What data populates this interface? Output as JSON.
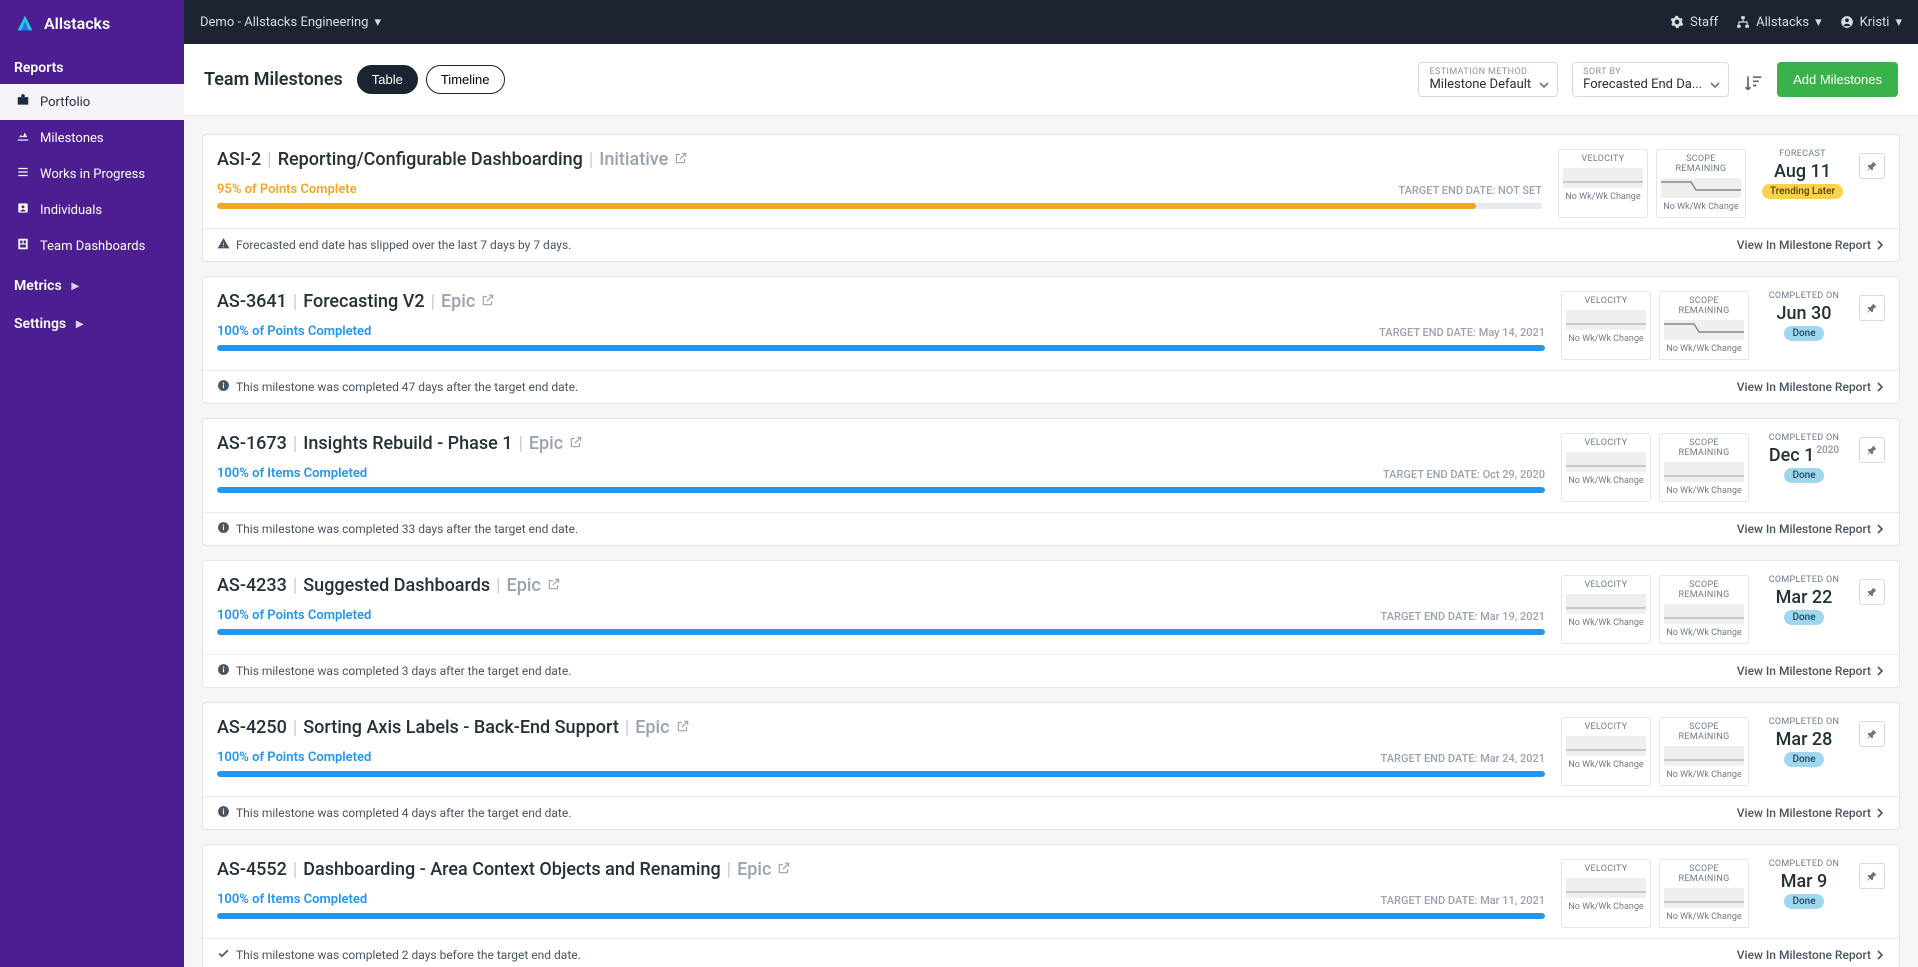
{
  "brand": {
    "name": "Allstacks"
  },
  "topbar": {
    "org": "Demo - Allstacks Engineering",
    "staff": "Staff",
    "product": "Allstacks",
    "user": "Kristi"
  },
  "sidebar": {
    "sections": {
      "reports_label": "Reports",
      "metrics_label": "Metrics",
      "settings_label": "Settings"
    },
    "reports": [
      {
        "label": "Portfolio",
        "active": true
      },
      {
        "label": "Milestones"
      },
      {
        "label": "Works in Progress"
      },
      {
        "label": "Individuals"
      },
      {
        "label": "Team Dashboards"
      }
    ]
  },
  "page": {
    "title": "Team Milestones",
    "tabs": {
      "table": "Table",
      "timeline": "Timeline"
    },
    "estimation_label": "ESTIMATION METHOD",
    "estimation_value": "Milestone Default",
    "sortby_label": "SORT BY",
    "sortby_value": "Forecasted End Da...",
    "add_button": "Add Milestones"
  },
  "card_labels": {
    "velocity": "VELOCITY",
    "scope": "SCOPE REMAINING",
    "forecast": "FORECAST",
    "completed_on": "COMPLETED ON",
    "no_change": "No Wk/Wk Change",
    "view_link": "View In Milestone Report"
  },
  "pills": {
    "trending_later": "Trending Later",
    "done": "Done"
  },
  "milestones": [
    {
      "key": "ASI-2",
      "title": "Reporting/Configurable Dashboarding",
      "type": "Initiative",
      "pct_text": "95% of Points Complete",
      "pct_color": "amber",
      "progress": 95,
      "target_label": "TARGET END DATE: NOT SET",
      "forecast_mode": "forecast",
      "forecast_date": "Aug 11",
      "year": "",
      "pill": "trending_later",
      "footer_icon": "warn",
      "footer_text": "Forecasted end date has slipped over the last 7 days by 7 days."
    },
    {
      "key": "AS-3641",
      "title": "Forecasting V2",
      "type": "Epic",
      "pct_text": "100% of Points Completed",
      "pct_color": "blue",
      "progress": 100,
      "target_label": "TARGET END DATE: May 14, 2021",
      "forecast_mode": "completed",
      "forecast_date": "Jun 30",
      "year": "",
      "pill": "done",
      "footer_icon": "info",
      "footer_text": "This milestone was completed 47 days after the target end date."
    },
    {
      "key": "AS-1673",
      "title": "Insights Rebuild - Phase 1",
      "type": "Epic",
      "pct_text": "100% of Items Completed",
      "pct_color": "blue",
      "progress": 100,
      "target_label": "TARGET END DATE: Oct 29, 2020",
      "forecast_mode": "completed",
      "forecast_date": "Dec 1",
      "year": "2020",
      "pill": "done",
      "footer_icon": "info",
      "footer_text": "This milestone was completed 33 days after the target end date."
    },
    {
      "key": "AS-4233",
      "title": "Suggested Dashboards",
      "type": "Epic",
      "pct_text": "100% of Points Completed",
      "pct_color": "blue",
      "progress": 100,
      "target_label": "TARGET END DATE: Mar 19, 2021",
      "forecast_mode": "completed",
      "forecast_date": "Mar 22",
      "year": "",
      "pill": "done",
      "footer_icon": "info",
      "footer_text": "This milestone was completed 3 days after the target end date."
    },
    {
      "key": "AS-4250",
      "title": "Sorting Axis Labels - Back-End Support",
      "type": "Epic",
      "pct_text": "100% of Points Completed",
      "pct_color": "blue",
      "progress": 100,
      "target_label": "TARGET END DATE: Mar 24, 2021",
      "forecast_mode": "completed",
      "forecast_date": "Mar 28",
      "year": "",
      "pill": "done",
      "footer_icon": "info",
      "footer_text": "This milestone was completed 4 days after the target end date."
    },
    {
      "key": "AS-4552",
      "title": "Dashboarding - Area Context Objects and Renaming",
      "type": "Epic",
      "pct_text": "100% of Items Completed",
      "pct_color": "blue",
      "progress": 100,
      "target_label": "TARGET END DATE: Mar 11, 2021",
      "forecast_mode": "completed",
      "forecast_date": "Mar 9",
      "year": "",
      "pill": "done",
      "footer_icon": "check",
      "footer_text": "This milestone was completed 2 days before the target end date."
    }
  ]
}
